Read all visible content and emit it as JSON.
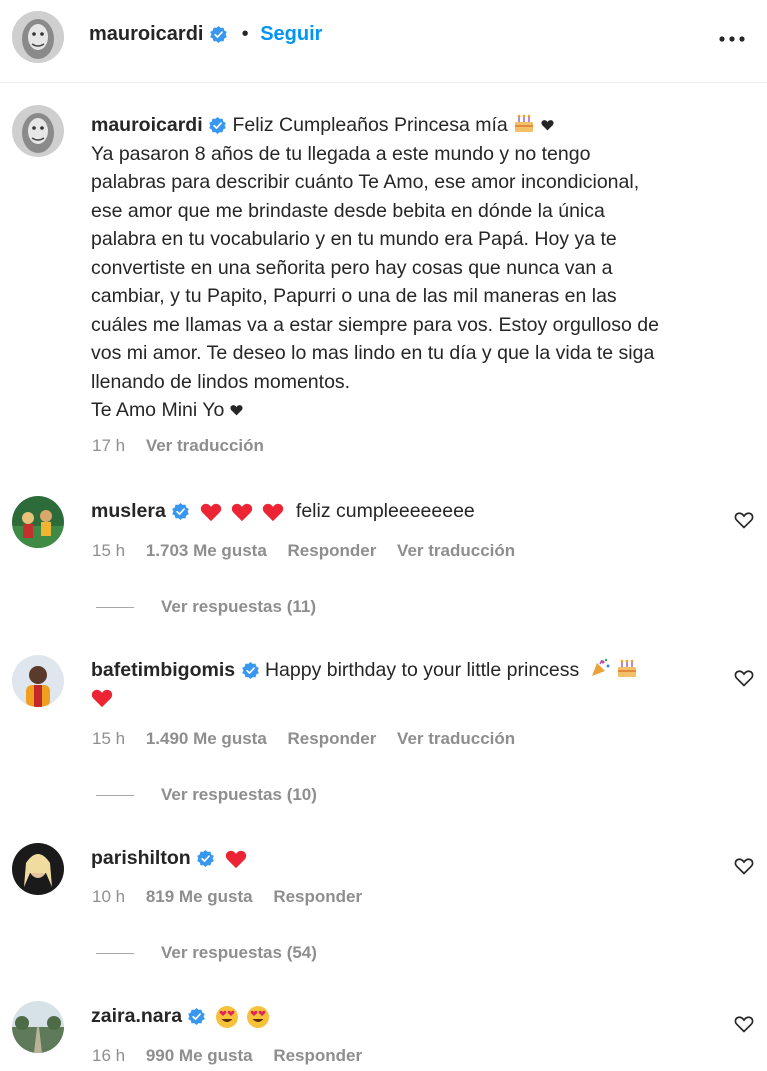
{
  "header": {
    "username": "mauroicardi",
    "separator": "•",
    "follow_label": "Seguir",
    "more_icon": "more-horizontal-icon"
  },
  "caption": {
    "username": "mauroicardi",
    "first_line": "Feliz Cumpleaños Princesa mía",
    "lines": [
      "Ya pasaron 8 años de tu llegada a este mundo y no tengo",
      "palabras para describir cuánto Te Amo, ese amor incondicional,",
      "ese amor que me brindaste desde bebita en dónde la única",
      "palabra en tu vocabulario y en tu mundo era Papá. Hoy ya te",
      "convertiste en una señorita pero hay cosas que nunca van a",
      "cambiar, y tu Papito, Papurri o una de las mil maneras en las",
      "cuáles me llamas va a estar siempre para vos. Estoy orgulloso de",
      "vos mi amor. Te deseo lo mas lindo en tu día y que la vida te siga",
      "llenando de lindos momentos."
    ],
    "last_line": "Te Amo Mini Yo",
    "time": "17 h",
    "translate_label": "Ver traducción"
  },
  "comments": [
    {
      "username": "muslera",
      "text": "feliz cumpleeeeeeee",
      "time": "15 h",
      "likes": "1.703 Me gusta",
      "reply_label": "Responder",
      "translate_label": "Ver traducción",
      "view_replies": "Ver respuestas (11)"
    },
    {
      "username": "bafetimbigomis",
      "text": "Happy birthday to your little princess",
      "time": "15 h",
      "likes": "1.490 Me gusta",
      "reply_label": "Responder",
      "translate_label": "Ver traducción",
      "view_replies": "Ver respuestas (10)"
    },
    {
      "username": "parishilton",
      "text": "",
      "time": "10 h",
      "likes": "819 Me gusta",
      "reply_label": "Responder",
      "view_replies": "Ver respuestas (54)"
    },
    {
      "username": "zaira.nara",
      "text": "",
      "time": "16 h",
      "likes": "990 Me gusta",
      "reply_label": "Responder"
    }
  ],
  "colors": {
    "link": "#0095f6",
    "verified": "#3897f0",
    "muted": "#8e8e8e",
    "heart_red": "#ed2433"
  }
}
